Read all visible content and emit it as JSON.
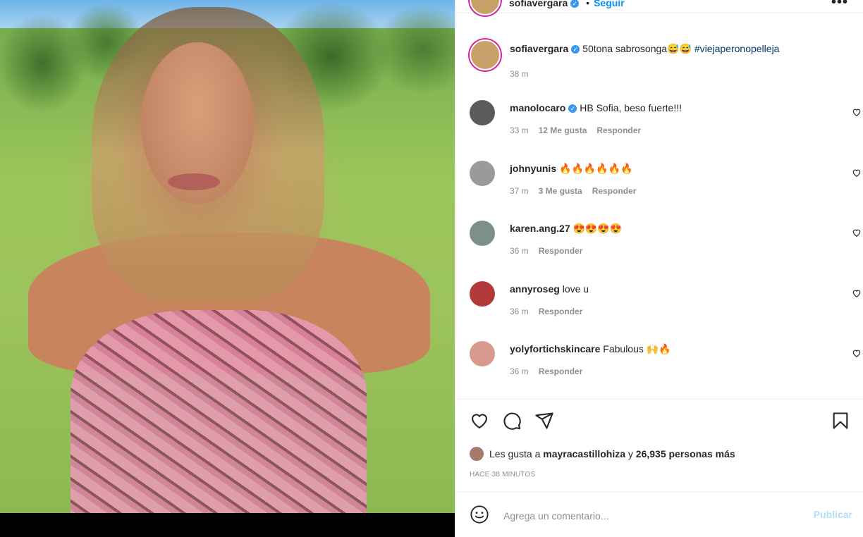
{
  "post": {
    "author": "sofiavergara",
    "follow_label": "Seguir",
    "separator": "•",
    "more_icon": "more-horizontal-icon",
    "caption_author": "sofiavergara",
    "caption_text": "50tona sabrosonga😅😅",
    "caption_hashtag": "#viejaperonopelleja",
    "caption_time": "38 m"
  },
  "comments": [
    {
      "user": "manolocaro",
      "verified": true,
      "text": "HB Sofia, beso fuerte!!!",
      "time": "33 m",
      "likes": "12 Me gusta",
      "reply": "Responder"
    },
    {
      "user": "johnyunis",
      "verified": false,
      "text": "🔥🔥🔥🔥🔥🔥",
      "time": "37 m",
      "likes": "3 Me gusta",
      "reply": "Responder"
    },
    {
      "user": "karen.ang.27",
      "verified": false,
      "text": "😍😍😍😍",
      "time": "36 m",
      "likes": "",
      "reply": "Responder"
    },
    {
      "user": "annyroseg",
      "verified": false,
      "text": "love u",
      "time": "36 m",
      "likes": "",
      "reply": "Responder"
    },
    {
      "user": "yolyfortichskincare",
      "verified": false,
      "text": "Fabulous 🙌🔥",
      "time": "36 m",
      "likes": "",
      "reply": "Responder"
    }
  ],
  "actions": {
    "like_icon": "heart-icon",
    "comment_icon": "comment-icon",
    "share_icon": "share-icon",
    "save_icon": "bookmark-icon"
  },
  "likes": {
    "prefix": "Les gusta a ",
    "user": "mayracastillohiza",
    "middle": " y ",
    "count": "26,935 personas más"
  },
  "timestamp": "HACE 38 MINUTOS",
  "comment_input": {
    "placeholder": "Agrega un comentario...",
    "publish_label": "Publicar",
    "emoji_icon": "smiley-icon"
  },
  "colors": {
    "link_blue": "#0095f6",
    "hashtag": "#00376b",
    "muted": "#8e8e8e",
    "publish_disabled": "#b2dffc"
  }
}
